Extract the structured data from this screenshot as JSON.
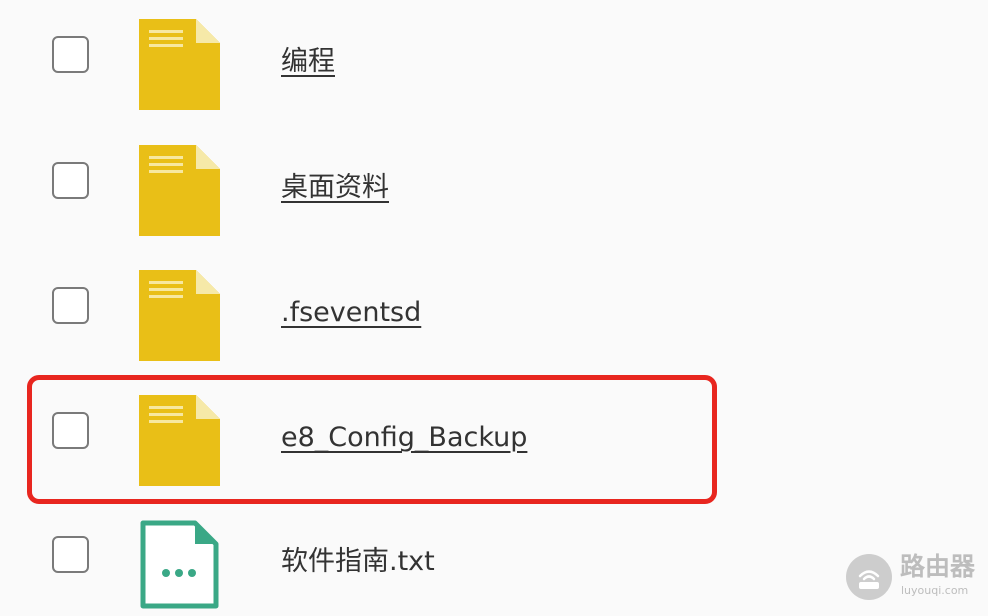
{
  "colors": {
    "folder": "#e9bf17",
    "folder_fold": "#f6e9a8",
    "text_file": "#3aa886",
    "highlight": "#e8261f"
  },
  "files": [
    {
      "name": "编程",
      "type": "folder",
      "icon": "folder-icon",
      "checked": false
    },
    {
      "name": "桌面资料",
      "type": "folder",
      "icon": "folder-icon",
      "checked": false
    },
    {
      "name": ".fseventsd",
      "type": "folder",
      "icon": "folder-icon",
      "checked": false
    },
    {
      "name": "e8_Config_Backup",
      "type": "folder",
      "icon": "folder-icon",
      "checked": false,
      "highlighted": true
    },
    {
      "name": "软件指南.txt",
      "type": "text",
      "icon": "text-file-icon",
      "checked": false
    }
  ],
  "watermark": {
    "title": "路由器",
    "subtitle": "luyouqi.com",
    "icon": "router-icon"
  }
}
